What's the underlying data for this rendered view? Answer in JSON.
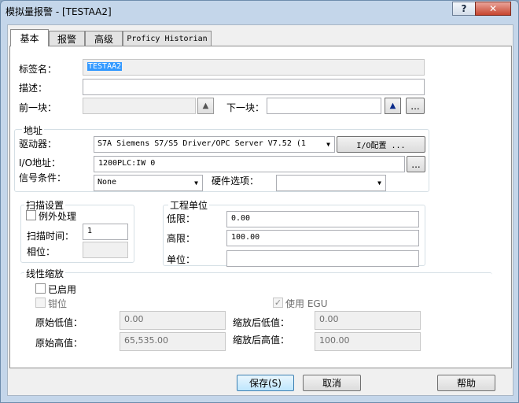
{
  "window": {
    "title": "模拟量报警 - [TESTAA2]",
    "help_glyph": "?",
    "close_glyph": "✕"
  },
  "tabs": [
    {
      "label": "基本"
    },
    {
      "label": "报警"
    },
    {
      "label": "高级"
    },
    {
      "label": "Proficy Historian"
    }
  ],
  "basic": {
    "tag_name_label": "标签名：",
    "tag_name_value": "TESTAA2",
    "description_label": "描述：",
    "description_value": "",
    "prev_block_label": "前一块：",
    "prev_block_value": "",
    "next_block_label": "下一块：",
    "next_block_value": "",
    "browse_label": "..."
  },
  "address": {
    "title": "地址",
    "driver_label": "驱动器：",
    "driver_value": "S7A    Siemens S7/S5 Driver/OPC Server V7.52 (1",
    "io_config_button": "I/O配置 ...",
    "io_address_label": "I/O地址：",
    "io_address_value": "1200PLC:IW 0",
    "browse_label": "...",
    "signal_condition_label": "信号条件：",
    "signal_condition_value": "None",
    "hardware_option_label": "硬件选项：",
    "hardware_option_value": ""
  },
  "scan": {
    "title": "扫描设置",
    "exception_label": "例外处理",
    "exception_checked": false,
    "scan_time_label": "扫描时间：",
    "scan_time_value": "1",
    "phase_label": "相位：",
    "phase_value": ""
  },
  "units": {
    "title": "工程单位",
    "low_label": "低限：",
    "low_value": "0.00",
    "high_label": "高限：",
    "high_value": "100.00",
    "unit_label": "单位：",
    "unit_value": ""
  },
  "linear": {
    "title": "线性缩放",
    "enabled_label": "已启用",
    "enabled_checked": false,
    "clamp_label": "钳位",
    "clamp_checked": false,
    "use_egu_label": "使用 EGU",
    "use_egu_checked": true,
    "raw_low_label": "原始低值：",
    "raw_low_value": "0.00",
    "raw_high_label": "原始高值：",
    "raw_high_value": "65,535.00",
    "scaled_low_label": "缩放后低值：",
    "scaled_low_value": "0.00",
    "scaled_high_label": "缩放后高值：",
    "scaled_high_value": "100.00"
  },
  "footer": {
    "save_label": "保存(S)",
    "cancel_label": "取消",
    "help_label": "帮助"
  },
  "icons": {
    "up_arrow": "▲",
    "dropdown_arrow": "▼",
    "check_mark": "✓"
  }
}
